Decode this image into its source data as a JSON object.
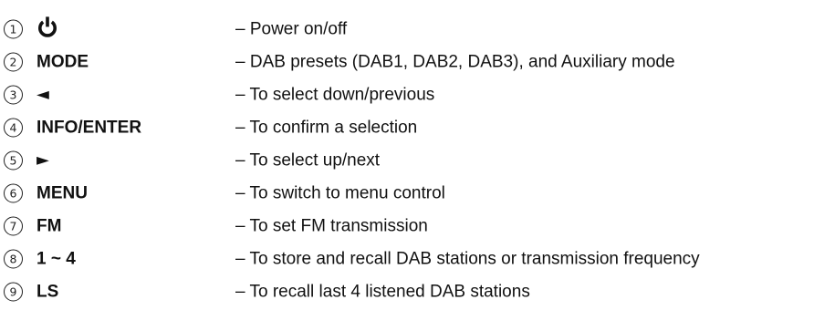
{
  "items": [
    {
      "number": "1",
      "key": "",
      "icon": "power-icon",
      "description": "– Power on/off"
    },
    {
      "number": "2",
      "key": "MODE",
      "description": "– DAB presets (DAB1, DAB2, DAB3), and Auxiliary mode"
    },
    {
      "number": "3",
      "key": "◄",
      "icon": "left-arrow-icon",
      "description": "– To select down/previous"
    },
    {
      "number": "4",
      "key": "INFO/ENTER",
      "description": "– To confirm a selection"
    },
    {
      "number": "5",
      "key": "►",
      "icon": "right-arrow-icon",
      "description": "– To select up/next"
    },
    {
      "number": "6",
      "key": "MENU",
      "description": "– To switch to menu control"
    },
    {
      "number": "7",
      "key": "FM",
      "description": "– To set FM transmission"
    },
    {
      "number": "8",
      "key": "1 ~ 4",
      "description": "– To store and recall DAB stations or transmission frequency"
    },
    {
      "number": "9",
      "key": "LS",
      "description": "– To recall last 4 listened DAB stations"
    }
  ]
}
